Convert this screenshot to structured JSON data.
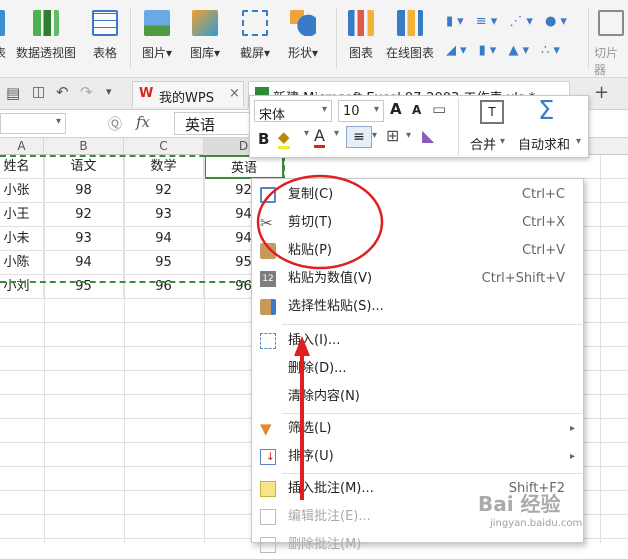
{
  "ribbon": {
    "items": [
      {
        "label": "表",
        "icon": "table-partial-icon"
      },
      {
        "label": "数据透视图",
        "icon": "pivot-chart-icon"
      },
      {
        "label": "表格",
        "icon": "table-icon"
      },
      {
        "label": "图片",
        "icon": "picture-icon"
      },
      {
        "label": "图库",
        "icon": "gallery-icon"
      },
      {
        "label": "截屏",
        "icon": "screenshot-icon"
      },
      {
        "label": "形状",
        "icon": "shapes-icon"
      },
      {
        "label": "图表",
        "icon": "chart-icon"
      },
      {
        "label": "在线图表",
        "icon": "online-chart-icon"
      },
      {
        "label": "切片器",
        "icon": "slicer-icon"
      }
    ]
  },
  "tabs": {
    "wps": "我的WPS",
    "file": "新建 Microsoft Excel 97-2003 工作表.xls *",
    "close": "×",
    "add": "+"
  },
  "formula": {
    "fx": "fx",
    "value": "英语"
  },
  "mini": {
    "font": "宋体",
    "size": "10",
    "grow": "A",
    "shrink": "A",
    "bold": "B",
    "fontcolor": "A",
    "merge": "合并",
    "autosum": "自动求和"
  },
  "columns": [
    "A",
    "B",
    "C",
    "D"
  ],
  "sheet": {
    "header": [
      "姓名",
      "语文",
      "数学",
      "英语"
    ],
    "rows": [
      [
        "小张",
        "98",
        "92",
        "92"
      ],
      [
        "小王",
        "92",
        "93",
        "94"
      ],
      [
        "小未",
        "93",
        "94",
        "94"
      ],
      [
        "小陈",
        "94",
        "95",
        "95"
      ],
      [
        "小刘",
        "95",
        "96",
        "96"
      ]
    ]
  },
  "menu": [
    {
      "label": "复制(C)",
      "shortcut": "Ctrl+C",
      "icon": "copy-icon"
    },
    {
      "label": "剪切(T)",
      "shortcut": "Ctrl+X",
      "icon": "cut-icon"
    },
    {
      "label": "粘贴(P)",
      "shortcut": "Ctrl+V",
      "icon": "paste-icon"
    },
    {
      "label": "粘贴为数值(V)",
      "shortcut": "Ctrl+Shift+V",
      "icon": "paste-values-icon"
    },
    {
      "label": "选择性粘贴(S)...",
      "shortcut": "",
      "icon": "paste-special-icon"
    },
    {
      "label": "插入(I)...",
      "shortcut": "",
      "icon": "insert-icon"
    },
    {
      "label": "删除(D)...",
      "shortcut": "",
      "icon": ""
    },
    {
      "label": "清除内容(N)",
      "shortcut": "",
      "icon": ""
    },
    {
      "label": "筛选(L)",
      "shortcut": "",
      "icon": "filter-icon"
    },
    {
      "label": "排序(U)",
      "shortcut": "",
      "icon": "sort-icon"
    },
    {
      "label": "插入批注(M)...",
      "shortcut": "Shift+F2",
      "icon": "insert-comment-icon"
    },
    {
      "label": "编辑批注(E)...",
      "shortcut": "",
      "icon": "edit-comment-icon"
    },
    {
      "label": "删除批注(M)",
      "shortcut": "",
      "icon": "delete-comment-icon"
    }
  ],
  "watermark": {
    "brand": "Bai 经验",
    "url": "jingyan.baidu.com"
  },
  "colors": {
    "accent": "#2e75b6",
    "highlight_red": "#e02020",
    "selection_green": "#3b8d3b"
  }
}
